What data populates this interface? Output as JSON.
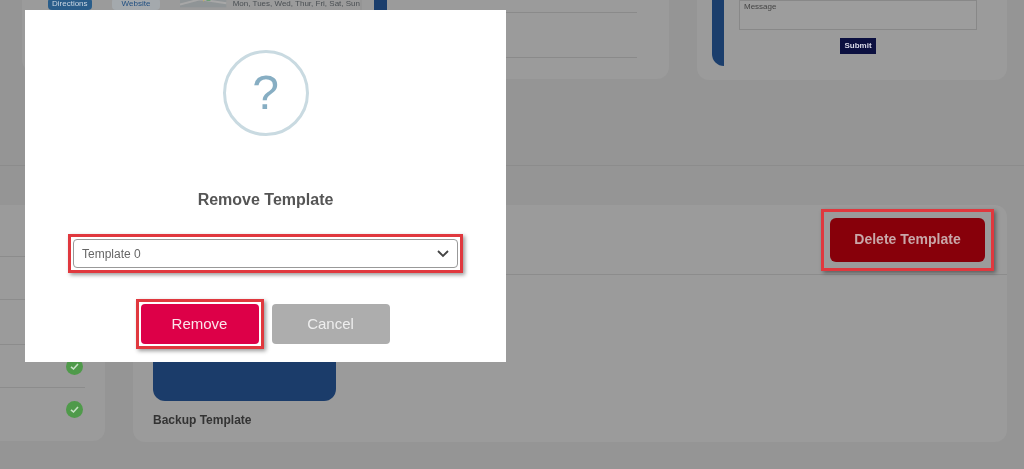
{
  "background": {
    "map_card": {
      "buttons": [
        "Directions",
        "Website"
      ],
      "hours": "Mon, Tues, Wed, Thur, Fri, Sat, Sun"
    },
    "contact_card": {
      "message_placeholder": "Message",
      "submit": "Submit"
    },
    "status_rows": [
      {
        "checked": true
      },
      {
        "checked": true
      }
    ],
    "template_panel": {
      "delete_button": {
        "label": "Delete Template",
        "highlighted": true
      },
      "templates": [
        {
          "name": "Backup Template"
        }
      ]
    }
  },
  "dialog": {
    "icon_glyph": "?",
    "title": "Remove Template",
    "select": {
      "value": "Template 0",
      "highlighted": true
    },
    "buttons": [
      {
        "label": "Remove",
        "kind": "primary",
        "highlighted": true
      },
      {
        "label": "Cancel",
        "kind": "secondary",
        "highlighted": false
      }
    ]
  }
}
